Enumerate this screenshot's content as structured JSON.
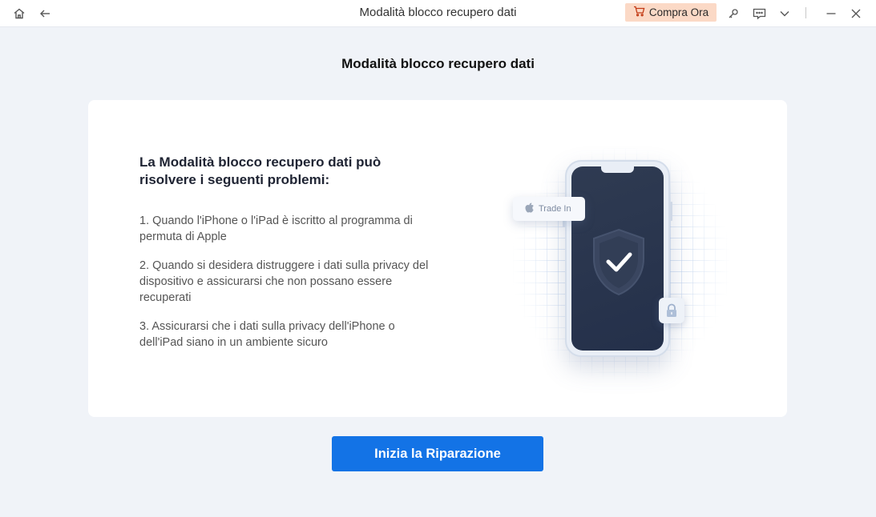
{
  "titlebar": {
    "title": "Modalità blocco recupero dati",
    "buy_label": "Compra Ora",
    "icons": [
      "home-icon",
      "back-icon",
      "cart-icon",
      "key-icon",
      "feedback-icon",
      "chevron-down-icon",
      "minimize-icon",
      "close-icon"
    ]
  },
  "main": {
    "heading": "Modalità blocco recupero dati",
    "card": {
      "title": "La Modalità blocco recupero dati può risolvere i seguenti problemi:",
      "items": [
        "1.  Quando l'iPhone o l'iPad è iscritto al programma di permuta di Apple",
        "2.  Quando si desidera distruggere i dati sulla privacy del dispositivo e assicurarsi che non possano essere recuperati",
        "3.  Assicurarsi che i dati sulla privacy dell'iPhone o dell'iPad siano in un ambiente sicuro"
      ],
      "illustration": {
        "badge_label": "Trade In",
        "icons": [
          "apple-icon",
          "shield-check-icon",
          "lock-icon"
        ]
      }
    },
    "start_button": "Inizia la Riparazione"
  },
  "colors": {
    "accent": "#1373e6",
    "buy_bg": "#fbd9c6",
    "background": "#f0f3f8",
    "phone_screen": "#2b364d"
  }
}
